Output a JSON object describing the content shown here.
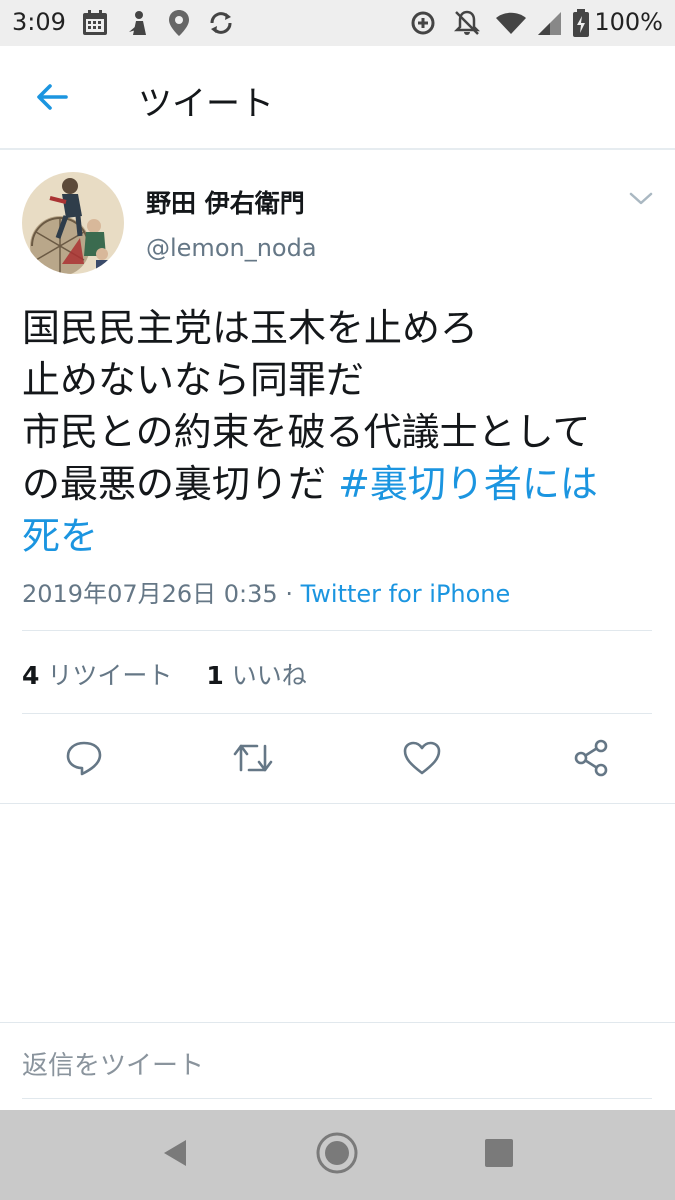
{
  "status_bar": {
    "time": "3:09",
    "battery": "100%",
    "icons": [
      "calendar-icon",
      "app-icon",
      "location-icon",
      "sync-icon",
      "data-saver-icon",
      "notifications-off-icon",
      "wifi-icon",
      "signal-icon",
      "battery-charging-icon"
    ]
  },
  "app_bar": {
    "title": "ツイート",
    "back_icon": "arrow-left-icon"
  },
  "tweet": {
    "user_name": "野田 伊右衛門",
    "handle": "@lemon_noda",
    "text_lines": [
      "国民民主党は玉木を止めろ",
      "止めないなら同罪だ",
      "市民との約束を破る代議士として",
      "の最悪の裏切りだ "
    ],
    "hashtag_part1": "#裏切り者には",
    "hashtag_part2": "死を",
    "date": "2019年07月26日 0:35",
    "separator": " · ",
    "source": "Twitter for iPhone",
    "retweet_count": "4",
    "retweet_label": "リツイート",
    "like_count": "1",
    "like_label": "いいね"
  },
  "actions": [
    "reply-icon",
    "retweet-icon",
    "like-icon",
    "share-icon"
  ],
  "reply": {
    "placeholder": "返信をツイート"
  },
  "colors": {
    "accent": "#1b95e0",
    "secondary_text": "#657786",
    "status_bar_bg": "#eeeeee",
    "nav_bar_bg": "#c9c9c9"
  }
}
